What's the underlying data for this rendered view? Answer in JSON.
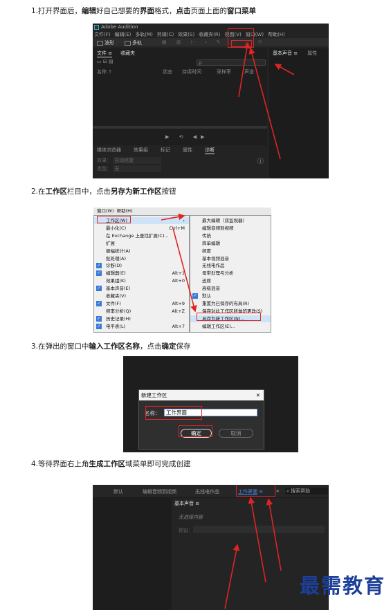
{
  "steps": [
    {
      "pre": "1.打开界面后，",
      "b1": "编辑",
      "mid1": "好自己想要的",
      "b2": "界面",
      "mid2": "格式，",
      "b3": "点击",
      "mid3": "页面上面的",
      "b4": "窗口菜单"
    },
    {
      "pre": "2.在",
      "b1": "工作区",
      "mid1": "栏目中，点击",
      "b2": "另存为新工作区",
      "mid2": "按钮"
    },
    {
      "pre": "3.在弹出的窗口中",
      "b1": "输入工作区名称",
      "mid1": "，点击",
      "b2": "确定",
      "mid2": "保存"
    },
    {
      "pre": "4.等待界面右上角",
      "b1": "生成工作区",
      "mid1": "域菜单即可完成创建"
    }
  ],
  "shot1": {
    "app_title": "Adobe Audition",
    "menu": [
      "文件(F)",
      "编辑(E)",
      "多轨(M)",
      "剪辑(C)",
      "效果(S)",
      "收藏夹(R)",
      "视图(V)",
      "窗口(W)",
      "帮助(H)"
    ],
    "toolbar": [
      "波形",
      "多轨"
    ],
    "panel_tabs": [
      "文件 ≡",
      "收藏夹"
    ],
    "columns": [
      "名称 ↑",
      "状态",
      "持续时间",
      "采样率",
      "声道"
    ],
    "right_tabs": [
      "基本声音 ≡",
      "属性"
    ],
    "search_placeholder": "ρ",
    "bottom_tabs": [
      "媒体浏览器",
      "效果组",
      "标记",
      "属性",
      "诊断"
    ],
    "bottom_rows": [
      {
        "label": "效果：",
        "value": "自动修复"
      },
      {
        "label": "类型：",
        "value": "无"
      }
    ]
  },
  "shot2": {
    "left_menu_header": [
      "窗口(W)",
      "帮助(H)"
    ],
    "left_items": [
      {
        "label": "工作区(W)",
        "sc": "",
        "check": false,
        "sel": true
      },
      {
        "label": "最小化(C)",
        "sc": "Ctrl+M",
        "check": false
      },
      {
        "label": "在 Exchange 上查找扩展(C)...",
        "sc": "",
        "check": false
      },
      {
        "label": "扩展",
        "sc": "",
        "check": false
      },
      {
        "label": "振幅统计(A)",
        "sc": "",
        "check": false
      },
      {
        "label": "批处理(A)",
        "sc": "",
        "check": false
      },
      {
        "label": "诊断(D)",
        "sc": "",
        "check": true
      },
      {
        "label": "编辑器(E)",
        "sc": "Alt+1",
        "check": true
      },
      {
        "label": "效果组(K)",
        "sc": "Alt+0",
        "check": false
      },
      {
        "label": "基本声音(E)",
        "sc": "",
        "check": true
      },
      {
        "label": "收藏夹(V)",
        "sc": "",
        "check": false
      },
      {
        "label": "文件(F)",
        "sc": "Alt+9",
        "check": true
      },
      {
        "label": "频率分析(Q)",
        "sc": "Alt+Z",
        "check": false
      },
      {
        "label": "历史记录(H)",
        "sc": "",
        "check": true
      },
      {
        "label": "电平表(L)",
        "sc": "Alt+7",
        "check": true
      }
    ],
    "right_items": [
      {
        "label": "最大编辑（双监视器）",
        "check": false
      },
      {
        "label": "编辑音频到视频",
        "check": false
      },
      {
        "label": "传统",
        "check": false
      },
      {
        "label": "简单编辑",
        "check": false
      },
      {
        "label": "频度",
        "check": false
      },
      {
        "label": "基本视频混音",
        "check": false
      },
      {
        "label": "无线电作品",
        "check": false
      },
      {
        "label": "母带处理与分析",
        "check": false
      },
      {
        "label": "还原",
        "check": false
      },
      {
        "label": "高级混音",
        "check": false
      },
      {
        "label": "默认",
        "check": true
      },
      {
        "label": "重置为已保存的布局(R)",
        "check": false
      },
      {
        "label": "保存对此工作区所做的更改(S)",
        "check": false
      },
      {
        "label": "另存为新工作区(N)...",
        "check": false,
        "sel": true
      },
      {
        "label": "编辑工作区(E)...",
        "check": false
      }
    ]
  },
  "shot3": {
    "dialog_title": "新建工作区",
    "close": "✕",
    "name_label": "名称：",
    "name_value": "工作界面",
    "ok": "确定",
    "cancel": "取消"
  },
  "shot4": {
    "tabs": [
      "默认",
      "编辑音频到视频",
      "无线电作品"
    ],
    "active_tab": "工作界面",
    "menu_icon": "≡",
    "more": "»",
    "search_text": "搜索帮助",
    "panel_title": "基本声音 ≡",
    "no_selection": "无选择内容",
    "preset_label": "预设："
  },
  "logo_text": "最需教育",
  "colors": {
    "highlight": "#e02424",
    "logo": "#1c3f9a",
    "active_tab": "#4a8cf0"
  }
}
